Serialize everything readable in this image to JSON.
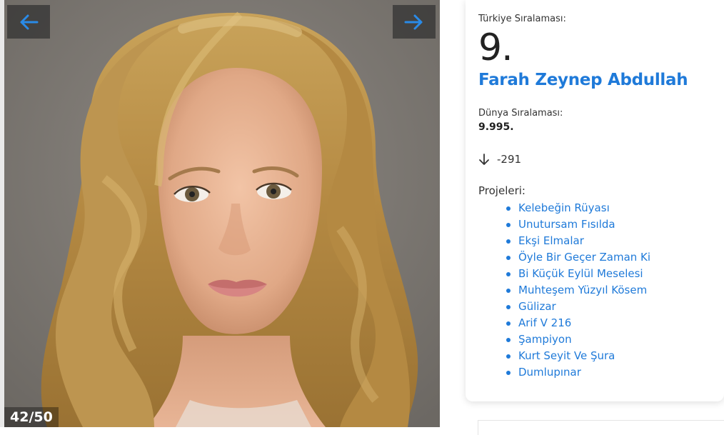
{
  "gallery": {
    "counter": "42/50",
    "prev_icon": "arrow-left-icon",
    "next_icon": "arrow-right-icon",
    "photo": "portrait-photo"
  },
  "info": {
    "turkey_rank_label": "Türkiye Sıralaması:",
    "turkey_rank": "9.",
    "name": "Farah Zeynep Abdullah",
    "world_rank_label": "Dünya Sıralaması:",
    "world_rank": "9.995.",
    "change_icon": "arrow-down-icon",
    "change": "-291",
    "projects_label": "Projeleri:",
    "projects": [
      "Kelebeğin Rüyası",
      "Unutursam Fısılda",
      "Ekşi Elmalar",
      "Öyle Bir Geçer Zaman Ki",
      "Bi Küçük Eylül Meselesi",
      "Muhteşem Yüzyıl Kösem",
      "Gülizar",
      "Arif V 216",
      "Şampiyon",
      "Kurt Seyit Ve Şura",
      "Dumlupınar"
    ]
  },
  "colors": {
    "accent": "#1f7ad9",
    "nav_arrow": "#2a8be8",
    "photo_background": "#7a7671"
  }
}
